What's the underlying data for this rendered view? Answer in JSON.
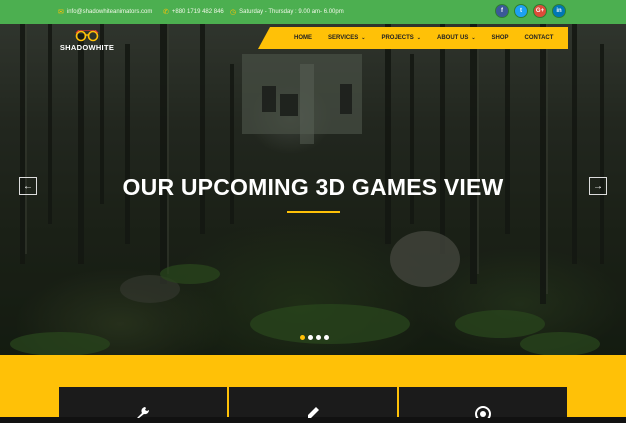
{
  "topbar": {
    "email": "info@shadowhiteanimators.com",
    "phone": "+880 1719 482 846",
    "hours": "Saturday - Thursday : 9.00 am- 6.00pm",
    "socials": [
      {
        "name": "facebook",
        "glyph": "f",
        "color": "#3b5998"
      },
      {
        "name": "twitter",
        "glyph": "t",
        "color": "#1da1f2"
      },
      {
        "name": "google-plus",
        "glyph": "G+",
        "color": "#dd4b39"
      },
      {
        "name": "linkedin",
        "glyph": "in",
        "color": "#0077b5"
      }
    ]
  },
  "logo": {
    "text": "SHADOWHITE"
  },
  "nav": {
    "items": [
      {
        "label": "HOME",
        "dropdown": false
      },
      {
        "label": "SERVICES",
        "dropdown": true
      },
      {
        "label": "PROJECTS",
        "dropdown": true
      },
      {
        "label": "ABOUT US",
        "dropdown": true
      },
      {
        "label": "SHOP",
        "dropdown": false
      },
      {
        "label": "CONTACT",
        "dropdown": false
      }
    ]
  },
  "hero": {
    "headline": "OUR UPCOMING 3D GAMES VIEW",
    "prev": "←",
    "next": "→",
    "slides": 4,
    "active_slide": 1
  },
  "colors": {
    "accent": "#ffc107",
    "topbar": "#4caf50",
    "card": "#1b1b1b"
  },
  "features": [
    {
      "icon": "wrench-icon"
    },
    {
      "icon": "pencil-icon"
    },
    {
      "icon": "target-icon"
    }
  ]
}
